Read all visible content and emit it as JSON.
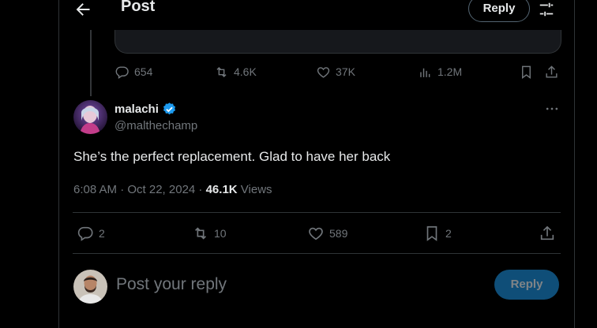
{
  "header": {
    "title": "Post",
    "reply_label": "Reply"
  },
  "parent_actions": {
    "replies": "654",
    "reposts": "4.6K",
    "likes": "37K",
    "views": "1.2M"
  },
  "tweet": {
    "name": "malachi",
    "handle": "@malthechamp",
    "text": "She’s the perfect replacement. Glad to have her back",
    "time": "6:08 AM · Oct 22, 2024 · ",
    "views_count": "46.1K",
    "views_label": " Views",
    "actions": {
      "replies": "2",
      "reposts": "10",
      "likes": "589",
      "bookmarks": "2"
    }
  },
  "composer": {
    "placeholder": "Post your reply",
    "button_label": "Reply"
  },
  "colors": {
    "background": "#000000",
    "accent": "#1d9bf0",
    "muted": "#71767b",
    "border": "#2f3336"
  }
}
